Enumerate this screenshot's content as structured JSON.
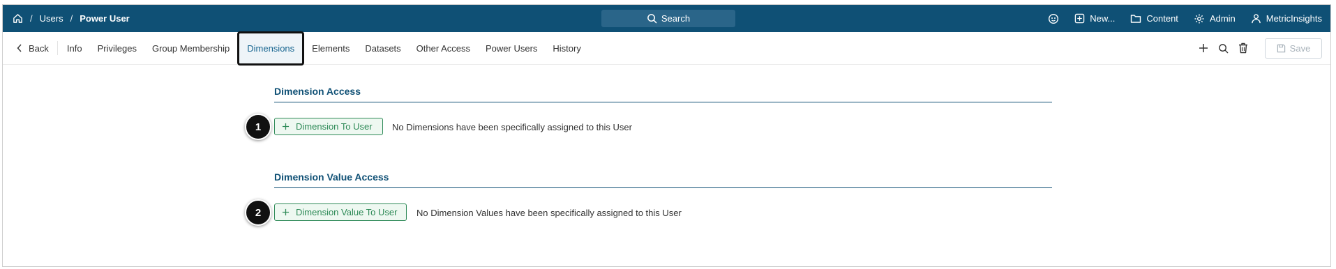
{
  "topbar": {
    "breadcrumb": [
      "Users",
      "Power User"
    ],
    "search_label": "Search",
    "menu": [
      {
        "icon": "favorites-icon",
        "label": ""
      },
      {
        "icon": "new-icon",
        "label": "New..."
      },
      {
        "icon": "folder-icon",
        "label": "Content"
      },
      {
        "icon": "gear-icon",
        "label": "Admin"
      },
      {
        "icon": "user-icon",
        "label": "MetricInsights"
      }
    ],
    "bg_color": "#0f5075"
  },
  "tabs": {
    "back": "Back",
    "items": [
      "Info",
      "Privileges",
      "Group Membership",
      "Dimensions",
      "Elements",
      "Datasets",
      "Other Access",
      "Power Users",
      "History"
    ],
    "active": "Dimensions",
    "save_label": "Save"
  },
  "sections": [
    {
      "title": "Dimension Access",
      "button": "Dimension To User",
      "note": "No Dimensions have been specifically assigned to this User",
      "badge": "1"
    },
    {
      "title": "Dimension Value Access",
      "button": "Dimension Value To User",
      "note": "No Dimension Values have been specifically assigned to this User",
      "badge": "2"
    }
  ],
  "colors": {
    "accent": "#0f5075",
    "button_green": "#2e8a57"
  }
}
